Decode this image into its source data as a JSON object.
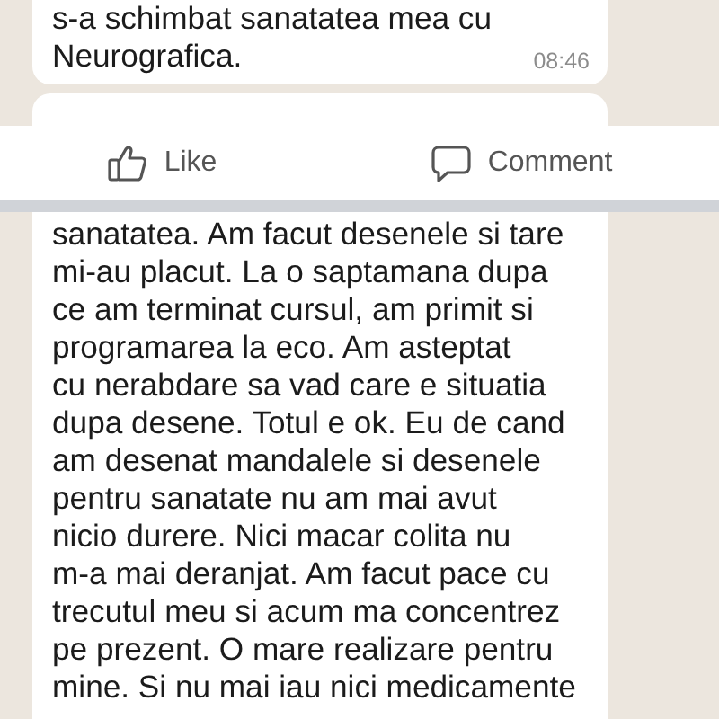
{
  "top_message": {
    "lines": [
      "s-a schimbat sanatatea mea cu",
      "Neurografica."
    ],
    "time": "08:46"
  },
  "actions": [
    {
      "kind": "like",
      "label": "Like"
    },
    {
      "kind": "comment",
      "label": "Comment"
    }
  ],
  "bottom_message": {
    "lines": [
      "sanatatea. Am facut desenele si tare",
      "mi-au placut. La o saptamana dupa",
      "ce am terminat cursul, am primit si",
      "programarea la eco. Am asteptat",
      "cu nerabdare sa vad care e situatia",
      "dupa desene. Totul e ok. Eu de cand",
      "am desenat mandalele si desenele",
      "pentru sanatate nu am mai avut",
      "nicio durere. Nici macar colita nu",
      "m-a mai deranjat. Am facut pace cu",
      "trecutul meu si acum ma concentrez",
      "pe prezent. O mare realizare pentru",
      "mine. Si nu mai iau nici medicamente"
    ]
  }
}
